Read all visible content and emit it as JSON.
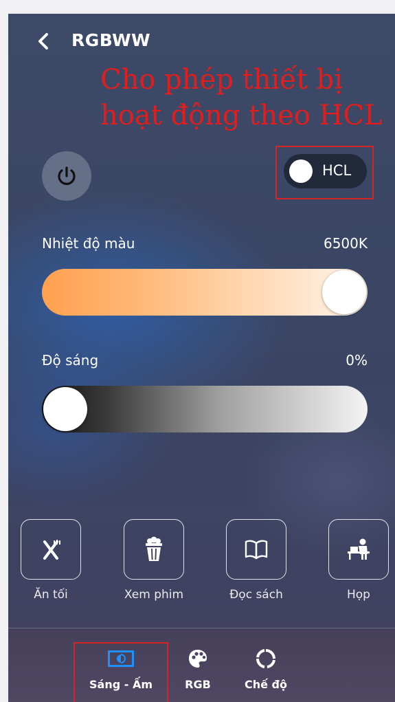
{
  "header": {
    "title": "RGBWW",
    "annotation_line1": "Cho phép thiết bị",
    "annotation_line2": "hoạt động theo HCL"
  },
  "controls": {
    "power_icon": "power-icon",
    "hcl_toggle_label": "HCL",
    "hcl_enabled": false
  },
  "color_temperature": {
    "label": "Nhiệt độ màu",
    "value": "6500K",
    "level": 1.0
  },
  "brightness": {
    "label": "Độ sáng",
    "value": "0%",
    "level": 0.0
  },
  "scenes": [
    {
      "label": "Ăn tối",
      "icon": "fork-knife-icon"
    },
    {
      "label": "Xem phim",
      "icon": "popcorn-icon"
    },
    {
      "label": "Đọc sách",
      "icon": "book-icon"
    },
    {
      "label": "Họp",
      "icon": "meeting-icon"
    }
  ],
  "bottom_nav": [
    {
      "label": "Sáng - Ấm",
      "icon": "white-warm-icon",
      "active": true
    },
    {
      "label": "RGB",
      "icon": "palette-icon",
      "active": false
    },
    {
      "label": "Chế độ",
      "icon": "mode-ring-icon",
      "active": false
    }
  ],
  "colors": {
    "annotation_red": "#e11d1d",
    "active_nav_blue": "#1e90ff",
    "temp_warm": "#ffa04e"
  }
}
